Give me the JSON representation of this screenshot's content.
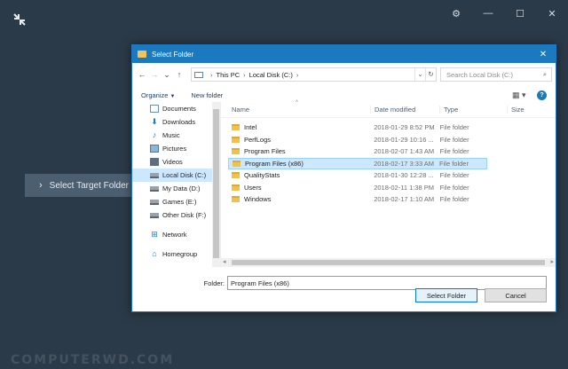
{
  "app": {
    "target_button_label": "Select Target Folder",
    "watermark": "COMPUTERWD.COM"
  },
  "dialog": {
    "title": "Select Folder",
    "address": {
      "crumbs": [
        "This PC",
        "Local Disk (C:)"
      ]
    },
    "search": {
      "placeholder": "Search Local Disk (C:)"
    },
    "toolbar": {
      "organize": "Organize",
      "new_folder": "New folder"
    },
    "nav": [
      {
        "label": "Documents",
        "icon": "documents-icon"
      },
      {
        "label": "Downloads",
        "icon": "downloads-icon"
      },
      {
        "label": "Music",
        "icon": "music-icon"
      },
      {
        "label": "Pictures",
        "icon": "pictures-icon"
      },
      {
        "label": "Videos",
        "icon": "videos-icon"
      },
      {
        "label": "Local Disk (C:)",
        "icon": "disk-icon",
        "selected": true
      },
      {
        "label": "My Data (D:)",
        "icon": "disk-icon"
      },
      {
        "label": "Games (E:)",
        "icon": "disk-icon"
      },
      {
        "label": "Other Disk (F:)",
        "icon": "disk-icon"
      },
      {
        "label": "Network",
        "icon": "network-icon"
      },
      {
        "label": "Homegroup",
        "icon": "homegroup-icon"
      }
    ],
    "columns": {
      "name": "Name",
      "date": "Date modified",
      "type": "Type",
      "size": "Size"
    },
    "files": [
      {
        "name": "Intel",
        "date": "2018-01-29 8:52 PM",
        "type": "File folder"
      },
      {
        "name": "PerfLogs",
        "date": "2018-01-29 10:16 ...",
        "type": "File folder"
      },
      {
        "name": "Program Files",
        "date": "2018-02-07 1:43 AM",
        "type": "File folder"
      },
      {
        "name": "Program Files (x86)",
        "date": "2018-02-17 3:33 AM",
        "type": "File folder",
        "selected": true
      },
      {
        "name": "QualityStats",
        "date": "2018-01-30 12:28 ...",
        "type": "File folder"
      },
      {
        "name": "Users",
        "date": "2018-02-11 1:38 PM",
        "type": "File folder"
      },
      {
        "name": "Windows",
        "date": "2018-02-17 1:10 AM",
        "type": "File folder"
      }
    ],
    "folder_label": "Folder:",
    "folder_value": "Program Files (x86)",
    "buttons": {
      "select": "Select Folder",
      "cancel": "Cancel"
    }
  }
}
